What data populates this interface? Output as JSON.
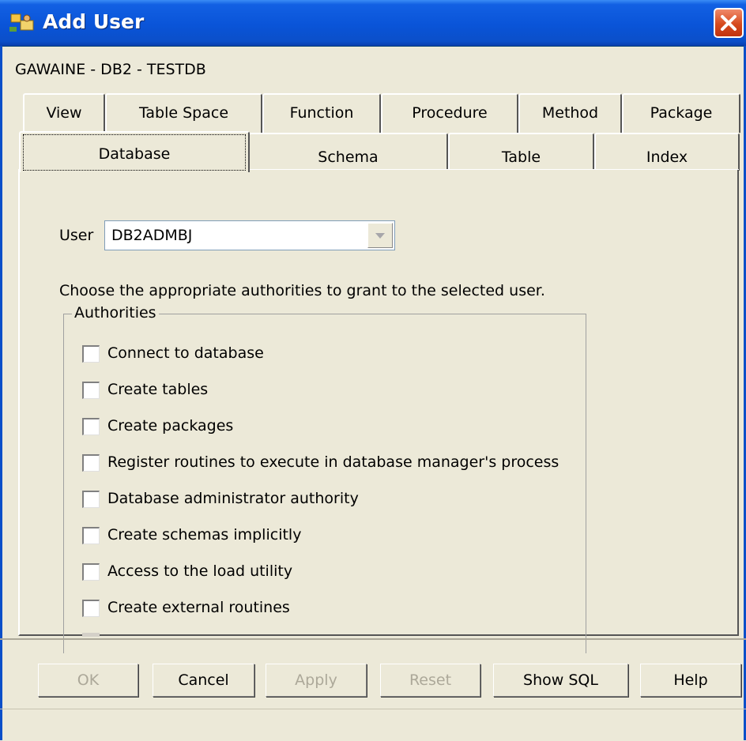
{
  "window": {
    "title": "Add User",
    "subtitle": "GAWAINE - DB2 - TESTDB",
    "icon": "users-icon",
    "close_icon": "close-icon"
  },
  "tabs_row_back": [
    {
      "label": "View"
    },
    {
      "label": "Table Space"
    },
    {
      "label": "Function"
    },
    {
      "label": "Procedure"
    },
    {
      "label": "Method"
    },
    {
      "label": "Package"
    }
  ],
  "tabs_row_front": [
    {
      "label": "Database",
      "active": true
    },
    {
      "label": "Schema"
    },
    {
      "label": "Table"
    },
    {
      "label": "Index"
    }
  ],
  "user": {
    "label": "User",
    "value": "DB2ADMBJ"
  },
  "prompt": "Choose the appropriate authorities to grant to the selected user.",
  "authorities": {
    "legend": "Authorities",
    "items": [
      {
        "label": "Connect to database",
        "checked": false
      },
      {
        "label": "Create tables",
        "checked": false
      },
      {
        "label": "Create packages",
        "checked": false
      },
      {
        "label": "Register routines to execute in database manager's process",
        "checked": false
      },
      {
        "label": "Database administrator authority",
        "checked": false
      },
      {
        "label": "Create schemas implicitly",
        "checked": false
      },
      {
        "label": "Access to the load utility",
        "checked": false
      },
      {
        "label": "Create external routines",
        "checked": false
      }
    ]
  },
  "buttons": {
    "ok": "OK",
    "cancel": "Cancel",
    "apply": "Apply",
    "reset": "Reset",
    "show_sql": "Show SQL",
    "help": "Help"
  },
  "colors": {
    "titlebar": "#0a54d8",
    "window_bg": "#ece9d8",
    "disabled_text": "#aca899"
  }
}
